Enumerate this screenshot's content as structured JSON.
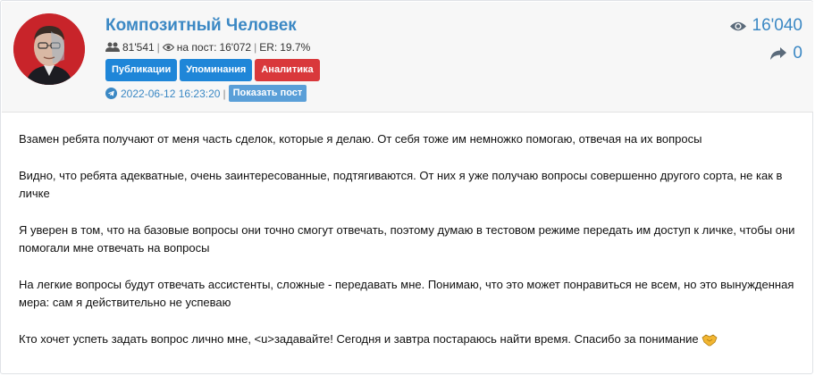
{
  "channel": {
    "name": "Композитный Человек",
    "subscribers": "81'541",
    "views_per_post_label": "на пост:",
    "views_per_post": "16'072",
    "er_label": "ER:",
    "er": "19.7%"
  },
  "buttons": {
    "publications": "Публикации",
    "mentions": "Упоминания",
    "analytics": "Аналитика"
  },
  "post": {
    "datetime": "2022-06-12 16:23:20",
    "show_post": "Показать пост",
    "views": "16'040",
    "shares": "0",
    "paragraphs": [
      "Взамен ребята получают от меня часть сделок, которые я делаю. От себя тоже им немножко помогаю, отвечая на их вопросы",
      "Видно, что ребята адекватные, очень заинтересованные, подтягиваются. От них я уже получаю вопросы совершенно другого сорта, не как в личке",
      "Я уверен в том, что на базовые вопросы они точно смогут отвечать, поэтому думаю в тестовом режиме передать им доступ к личке, чтобы они помогали мне отвечать на вопросы",
      "На легкие вопросы будут отвечать ассистенты, сложные - передавать мне. Понимаю, что это может понравиться не всем, но это вынужденная мера: сам я действительно не успеваю",
      "Кто хочет успеть задать вопрос лично мне, <u>задавайте! Сегодня и завтра постараюсь найти время. Спасибо за понимание"
    ]
  },
  "colors": {
    "title": "#3b88c4",
    "button_blue": "#1f86d8",
    "button_red": "#d9383b",
    "show_post": "#5a9fd8",
    "header_bg": "#f7f7f7"
  },
  "icons": [
    "users-icon",
    "eye-icon",
    "telegram-icon",
    "share-icon",
    "handshake-emoji"
  ]
}
